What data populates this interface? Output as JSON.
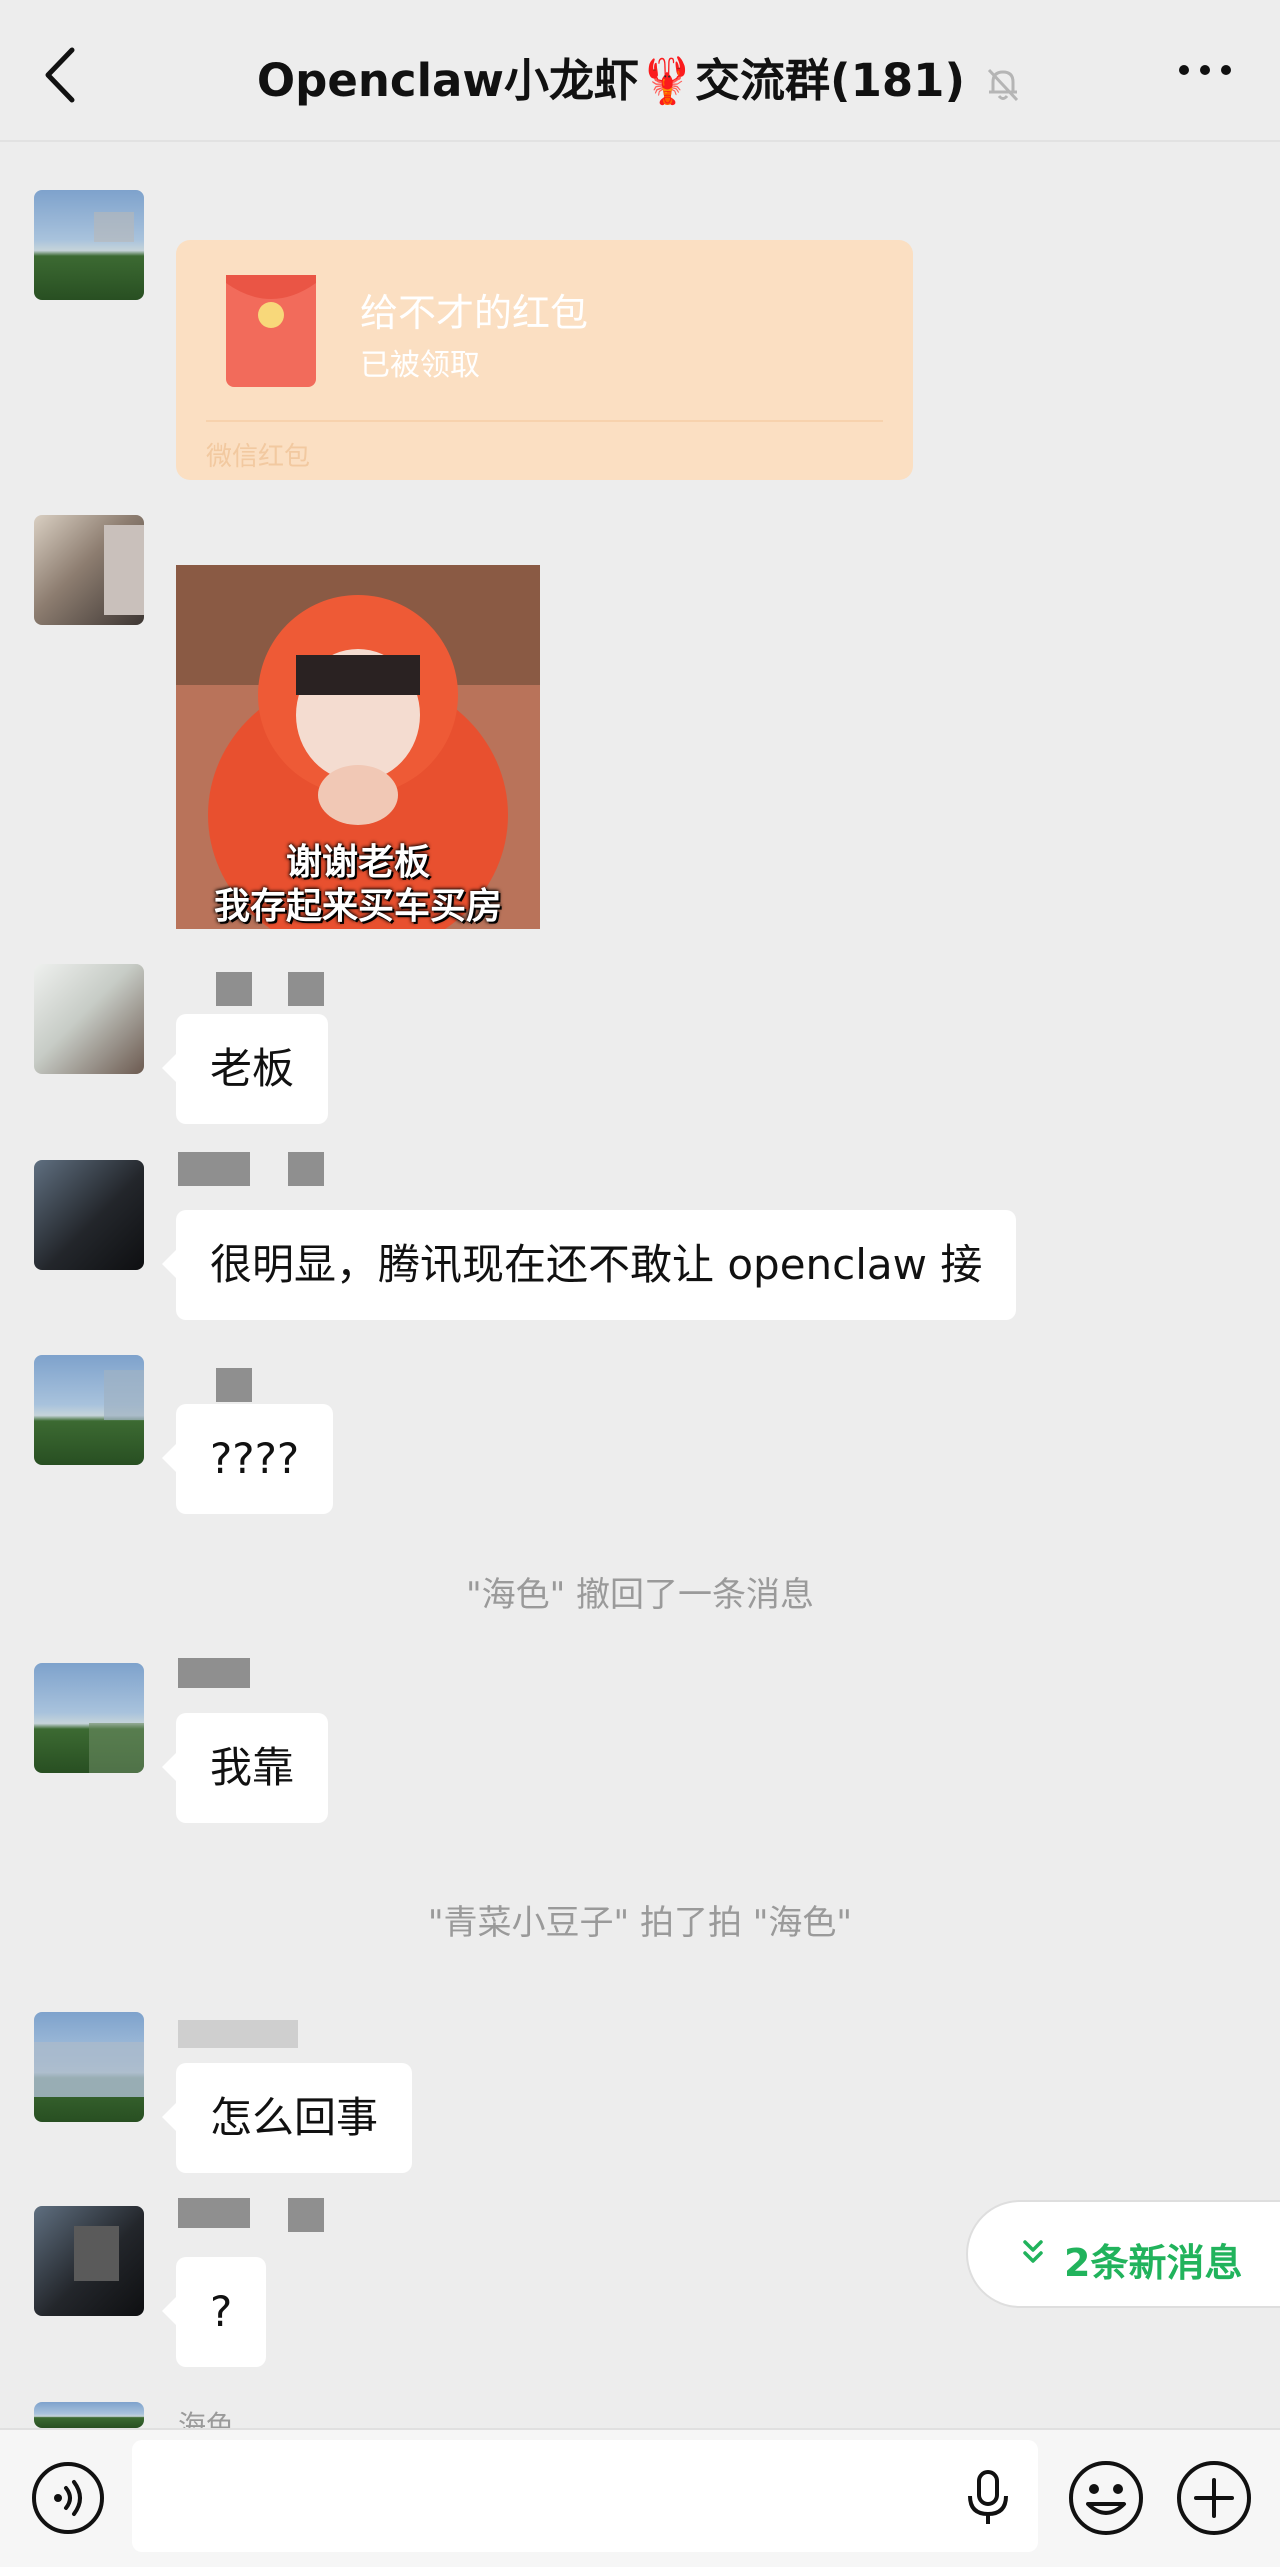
{
  "header": {
    "title": "Openclaw小龙虾🦞交流群(181)",
    "icons": [
      "back-arrow-icon",
      "muted-bell-icon",
      "more-icon"
    ]
  },
  "messages": {
    "red_packet": {
      "title": "给不才的红包",
      "status": "已被领取",
      "footer": "微信红包"
    },
    "sticker": {
      "caption_line1": "谢谢老板",
      "caption_line2": "我存起来买车买房"
    },
    "msg3": "老板",
    "msg4": "很明显，腾讯现在还不敢让 openclaw 接",
    "msg5": "????",
    "system1": "\"海色\" 撤回了一条消息",
    "msg6": "我靠",
    "system2": "\"青菜小豆子\" 拍了拍 \"海色\"",
    "msg7": "怎么回事",
    "msg8": "?",
    "last_sender": "海色"
  },
  "new_messages": {
    "label": "2条新消息"
  },
  "input_bar": {
    "value": "",
    "icons": [
      "voice-icon",
      "mic-icon",
      "emoji-icon",
      "plus-icon"
    ]
  },
  "colors": {
    "background": "#ededed",
    "bubble": "#ffffff",
    "red_packet": "#fbdfc2",
    "accent_green": "#21b35c"
  }
}
